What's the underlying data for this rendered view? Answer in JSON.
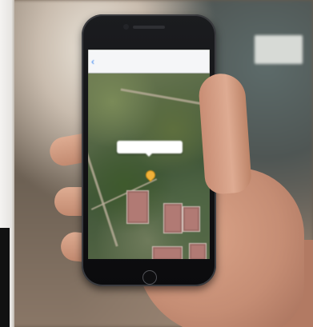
{
  "photo": {
    "subject": "hand-holding-phone"
  },
  "phone_screen": {
    "navbar": {
      "back_label": "",
      "title": ""
    },
    "map": {
      "callout_text": "",
      "pin_color": "#f0b23a"
    }
  },
  "colors": {
    "ios_blue": "#2a7df0",
    "phone_body": "#0b0b0d"
  }
}
